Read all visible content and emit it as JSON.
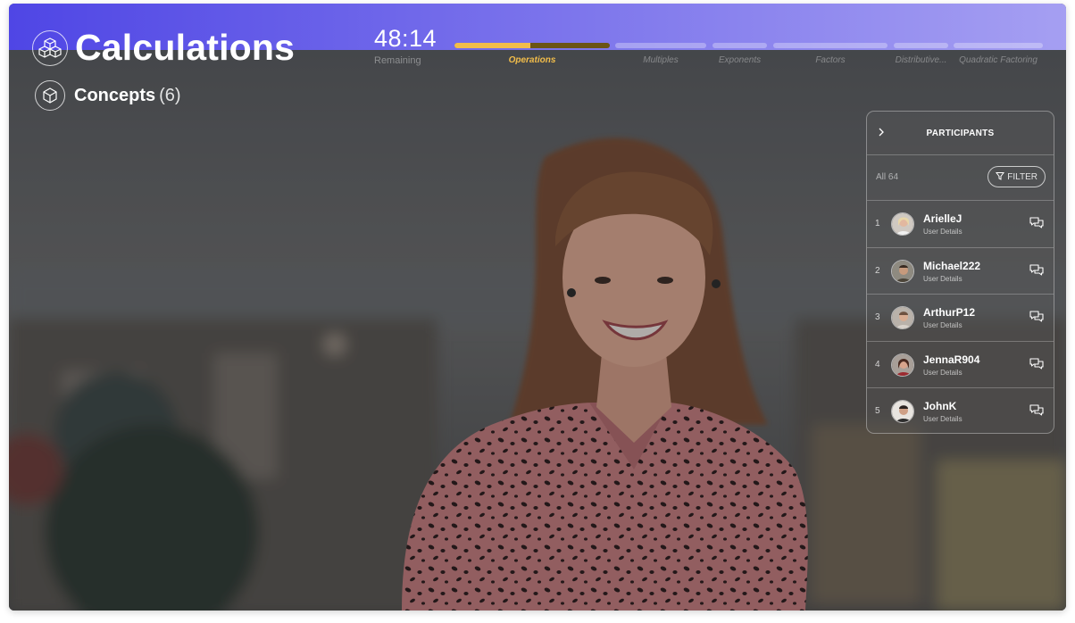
{
  "colors": {
    "topbar_gradient_start": "#4f46e5",
    "topbar_gradient_end": "#a59ff2",
    "progress_accent": "#f2bd4a"
  },
  "header": {
    "title": "Calculations",
    "title_icon": "cubes-icon",
    "concepts_label": "Concepts",
    "concepts_count": "(6)",
    "concepts_icon": "cube-icon"
  },
  "timer": {
    "value": "48:14",
    "label": "Remaining"
  },
  "progress": {
    "segments": [
      {
        "label": "Operations",
        "active": true,
        "progress": 0.49
      },
      {
        "label": "Multiples",
        "active": false,
        "progress": 0
      },
      {
        "label": "Exponents",
        "active": false,
        "progress": 0
      },
      {
        "label": "Factors",
        "active": false,
        "progress": 0
      },
      {
        "label": "Distributive...",
        "active": false,
        "progress": 0
      },
      {
        "label": "Quadratic Factoring",
        "active": false,
        "progress": 0
      }
    ]
  },
  "participants": {
    "title": "PARTICIPANTS",
    "collapse_icon": "chevron-right-icon",
    "all_label": "All 64",
    "filter_label": "FILTER",
    "filter_icon": "funnel-icon",
    "rows": [
      {
        "num": "1",
        "name": "ArielleJ",
        "sub": "User Details"
      },
      {
        "num": "2",
        "name": "Michael222",
        "sub": "User Details"
      },
      {
        "num": "3",
        "name": "ArthurP12",
        "sub": "User Details"
      },
      {
        "num": "4",
        "name": "JennaR904",
        "sub": "User Details"
      },
      {
        "num": "5",
        "name": "JohnK",
        "sub": "User Details"
      }
    ],
    "chat_icon": "chat-bubbles-icon"
  }
}
